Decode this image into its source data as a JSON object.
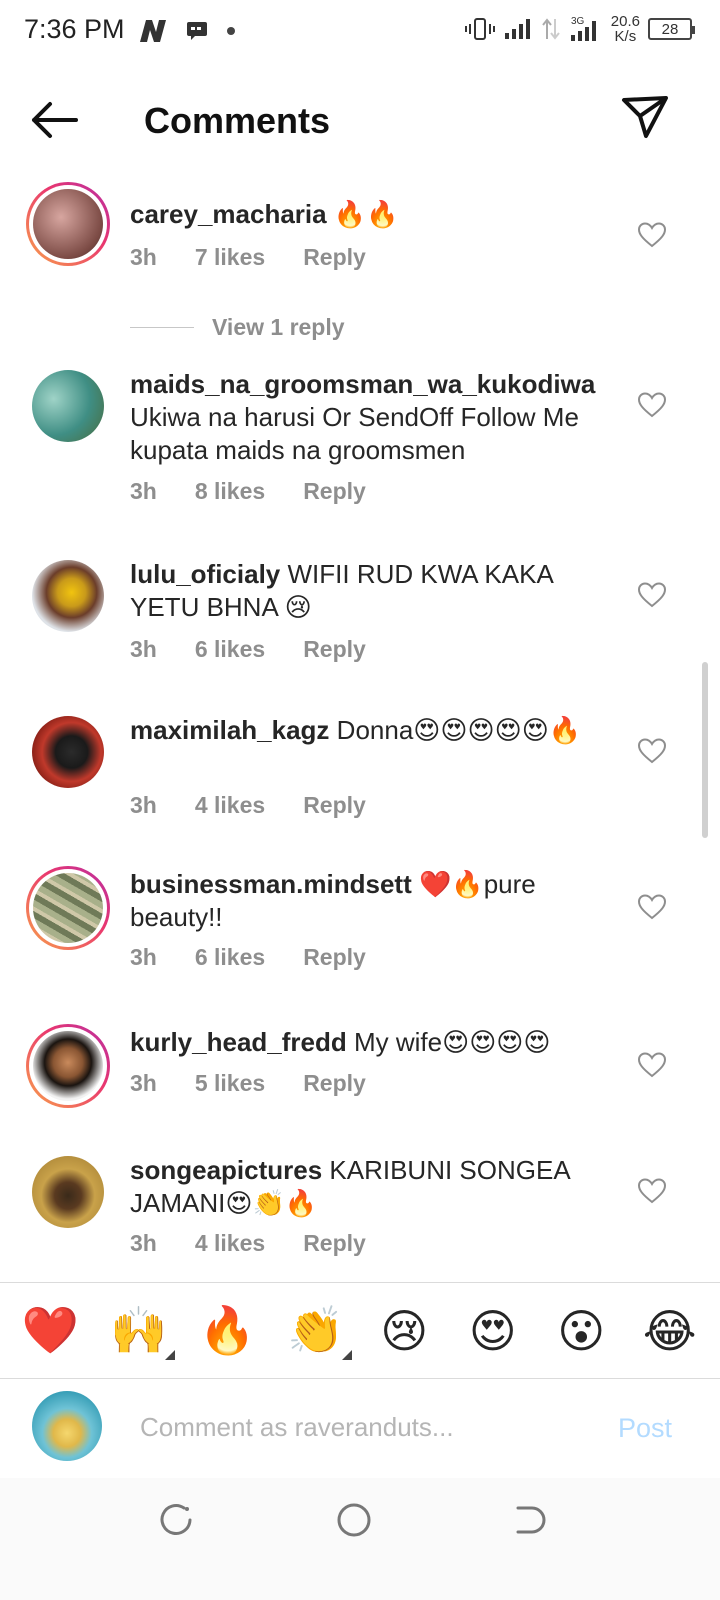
{
  "status_bar": {
    "time": "7:36 PM",
    "network_type": "3G",
    "net_speed_value": "20.6",
    "net_speed_unit": "K/s",
    "battery": "28"
  },
  "header": {
    "title": "Comments"
  },
  "comments": [
    {
      "username": "carey_macharia",
      "text": "🔥🔥",
      "time": "3h",
      "likes": "7 likes",
      "reply": "Reply",
      "view_replies": "View 1 reply"
    },
    {
      "username": "maids_na_groomsman_wa_kukodiwa",
      "text": "Ukiwa na harusi Or SendOff Follow Me kupata  maids na groomsmen",
      "time": "3h",
      "likes": "8 likes",
      "reply": "Reply"
    },
    {
      "username": "lulu_oficialy",
      "text": "WIFII RUD KWA KAKA YETU BHNA 😢",
      "time": "3h",
      "likes": "6 likes",
      "reply": "Reply"
    },
    {
      "username": "maximilah_kagz",
      "text": "Donna😍😍😍😍😍🔥",
      "time": "3h",
      "likes": "4 likes",
      "reply": "Reply"
    },
    {
      "username": "businessman.mindsett",
      "text": "❤️🔥pure beauty!!",
      "time": "3h",
      "likes": "6 likes",
      "reply": "Reply"
    },
    {
      "username": "kurly_head_fredd",
      "text": "My wife😍😍😍😍",
      "time": "3h",
      "likes": "5 likes",
      "reply": "Reply"
    },
    {
      "username": "songeapictures",
      "text": "KARIBUNI SONGEA JAMANI😍👏🔥",
      "time": "3h",
      "likes": "4 likes",
      "reply": "Reply"
    }
  ],
  "emoji_bar": [
    "❤️",
    "🙌",
    "🔥",
    "👏",
    "😢",
    "😍",
    "😮",
    "😂"
  ],
  "input": {
    "placeholder": "Comment as raveranduts...",
    "post_label": "Post"
  },
  "colors": {
    "post_disabled": "#b3dbff",
    "meta_gray": "#8e8e8e",
    "story_ring_start": "#f9a34b",
    "story_ring_end": "#b52ea6"
  }
}
